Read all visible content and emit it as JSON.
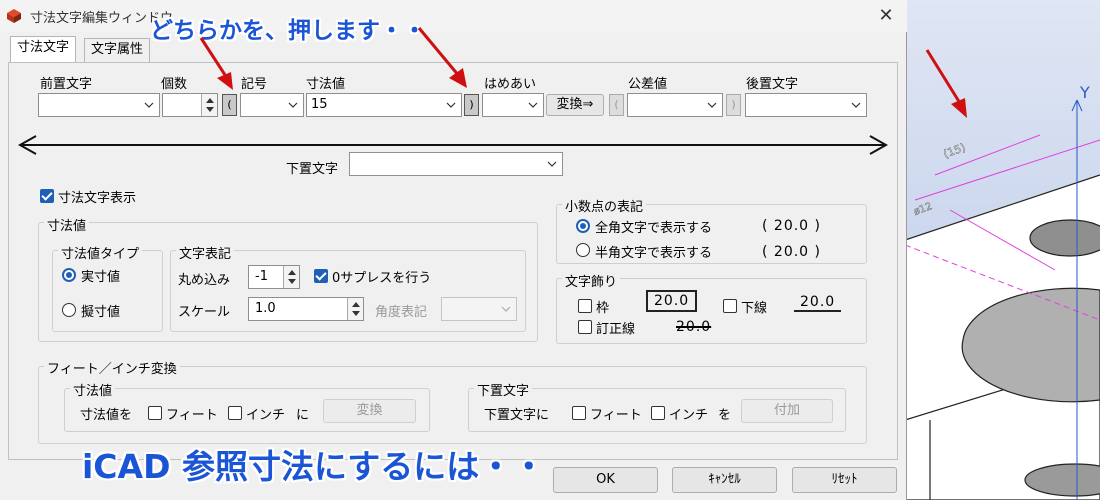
{
  "window": {
    "title": "寸法文字編集ウィンドウ",
    "close": "✕",
    "icon": "app-icon",
    "accent": "#1f5fb8"
  },
  "tabs": [
    {
      "label": "寸法文字",
      "active": true
    },
    {
      "label": "文字属性",
      "active": false
    }
  ],
  "top_row": {
    "prefix": {
      "label": "前置文字",
      "value": ""
    },
    "count": {
      "label": "個数",
      "value": ""
    },
    "bracket_left": "(",
    "symbol": {
      "label": "記号",
      "value": ""
    },
    "dim_value": {
      "label": "寸法値",
      "value": "15"
    },
    "bracket_right": ")",
    "fit": {
      "label": "はめあい",
      "value": ""
    },
    "convert_button": "変換⇒",
    "tol_bracket_left": "(",
    "tolerance": {
      "label": "公差値",
      "value": ""
    },
    "tol_bracket_right": ")",
    "suffix": {
      "label": "後置文字",
      "value": ""
    }
  },
  "under_text": {
    "label": "下置文字",
    "value": ""
  },
  "show_dim_text": {
    "label": "寸法文字表示",
    "checked": true
  },
  "dim_value_group": {
    "title": "寸法値",
    "type_group": {
      "title": "寸法値タイプ",
      "options": [
        {
          "label": "実寸値",
          "selected": true
        },
        {
          "label": "擬寸値",
          "selected": false
        }
      ]
    },
    "text_group": {
      "title": "文字表記",
      "rounding": {
        "label": "丸め込み",
        "value": "-1"
      },
      "zero_suppress": {
        "label": "0サプレスを行う",
        "checked": true
      },
      "scale": {
        "label": "スケール",
        "value": "1.0"
      },
      "angle": {
        "label": "角度表記",
        "value": ""
      }
    }
  },
  "decimal_group": {
    "title": "小数点の表記",
    "options": [
      {
        "label": "全角文字で表示する",
        "sample": "( 20.0 )",
        "selected": true
      },
      {
        "label": "半角文字で表示する",
        "sample": "( 20.0 )",
        "selected": false
      }
    ]
  },
  "decoration_group": {
    "title": "文字飾り",
    "frame": {
      "label": "枠",
      "checked": false,
      "sample": "20.0"
    },
    "underline": {
      "label": "下線",
      "checked": false,
      "sample": "20.0"
    },
    "strike": {
      "label": "訂正線",
      "checked": false,
      "sample": "20.0"
    }
  },
  "feet_inch": {
    "title": "フィート／インチ変換",
    "dim_value": {
      "title": "寸法値",
      "prefix": "寸法値を",
      "feet": "フィート",
      "inch": "インチ",
      "suffix": "に",
      "button": "変換"
    },
    "under_text": {
      "title": "下置文字",
      "prefix": "下置文字に",
      "feet": "フィート",
      "inch": "インチ",
      "suffix": "を",
      "button": "付加"
    }
  },
  "footer": {
    "ok": "OK",
    "cancel": "ｷｬﾝｾﾙ",
    "reset": "ﾘｾｯﾄ"
  },
  "annotations": {
    "top": "どちらかを、押します・・",
    "bottom": "iCAD 参照寸法にするには・・",
    "color": "#1a55d6",
    "arrow_color": "#d01010"
  },
  "viewport": {
    "axis_label": "Y",
    "dim_text_1": "(15)",
    "dim_text_2": "ø12"
  }
}
